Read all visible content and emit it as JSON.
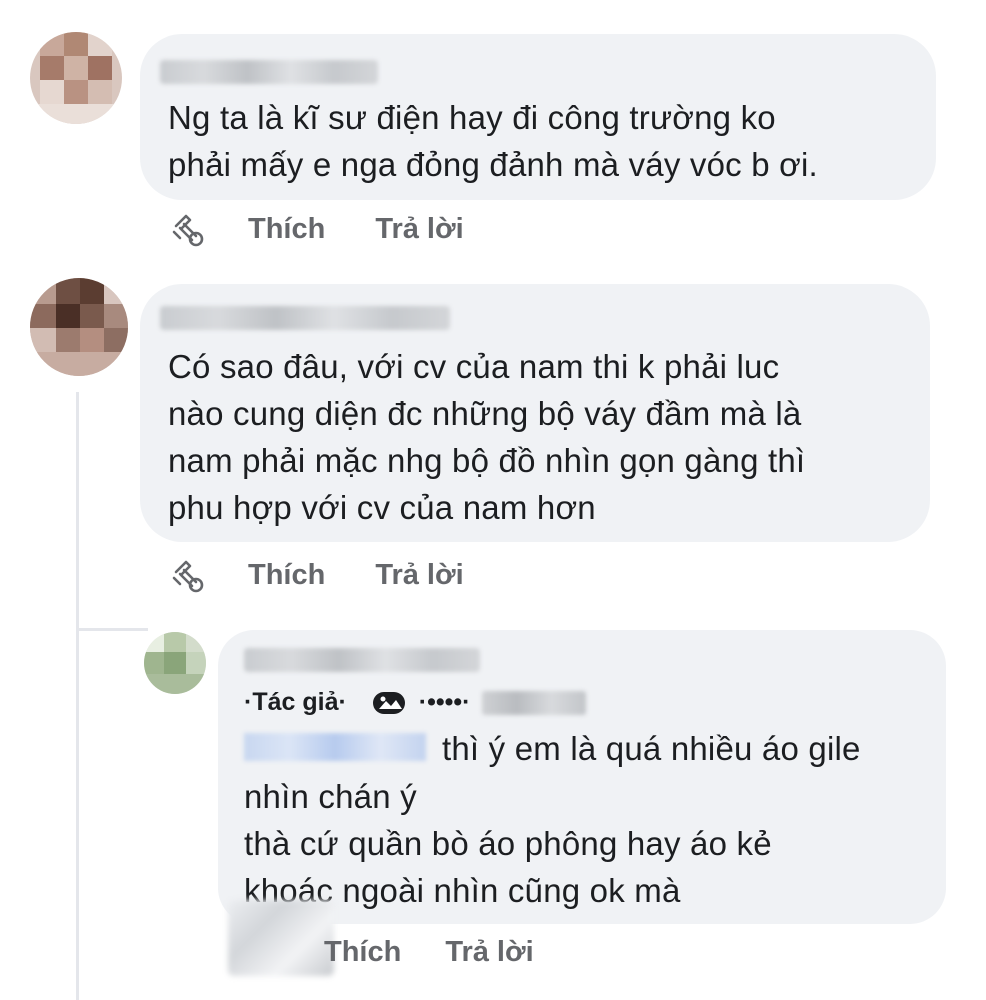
{
  "comments": [
    {
      "text": "Ng ta là kĩ sư điện hay đi công trường ko\nphải mấy e nga đỏng đảnh mà váy vóc b ơi.",
      "like_label": "Thích",
      "reply_label": "Trả lời"
    },
    {
      "text": "Có sao đâu, với cv của nam thi k phải luc\nnào cung diện đc những bộ váy đầm mà là\nnam phải mặc nhg bộ đồ nhìn gọn gàng thì\nphu hợp với cv của nam hơn",
      "like_label": "Thích",
      "reply_label": "Trả lời"
    }
  ],
  "reply": {
    "author_badge": "·Tác giả·",
    "badge_dots": "·••••·",
    "text_line1": "thì ý em là quá nhiều áo gile",
    "text_rest": "nhìn chán ý\nthà cứ quần bò áo phông hay áo kẻ\nkhoác ngoài nhìn cũng ok mà",
    "like_label": "Thích",
    "reply_label": "Trả lời"
  },
  "colors": {
    "bubble": "#f0f2f5",
    "text": "#1c1e21",
    "muted": "#65676b",
    "thread_line": "#e4e6eb"
  },
  "icons": {
    "reaction": "reaction-icon",
    "top_fan": "top-fan-badge-icon"
  }
}
